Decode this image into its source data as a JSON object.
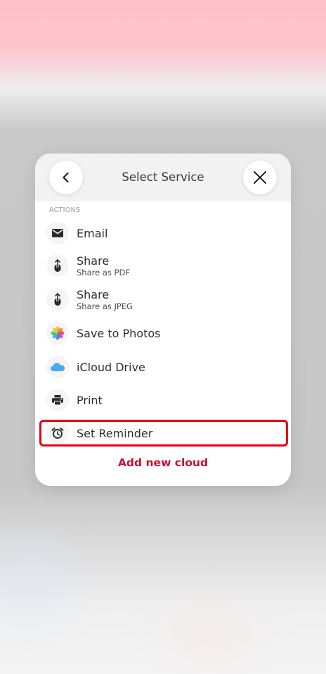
{
  "header": {
    "title": "Select Service"
  },
  "section": {
    "actions_label": "ACTIONS"
  },
  "items": [
    {
      "label": "Email",
      "icon": "mail-icon"
    },
    {
      "label": "Share",
      "sub": "Share as PDF",
      "icon": "share-icon"
    },
    {
      "label": "Share",
      "sub": "Share as JPEG",
      "icon": "share-icon"
    },
    {
      "label": "Save to Photos",
      "icon": "photos-icon"
    },
    {
      "label": "iCloud Drive",
      "icon": "icloud-icon"
    },
    {
      "label": "Print",
      "icon": "printer-icon"
    },
    {
      "label": "Set Reminder",
      "icon": "alarm-clock-icon"
    }
  ],
  "footer": {
    "add_cloud_label": "Add new cloud"
  },
  "colors": {
    "accent": "#c8102e",
    "highlight": "#e50012",
    "icloud": "#4aa8f0"
  }
}
